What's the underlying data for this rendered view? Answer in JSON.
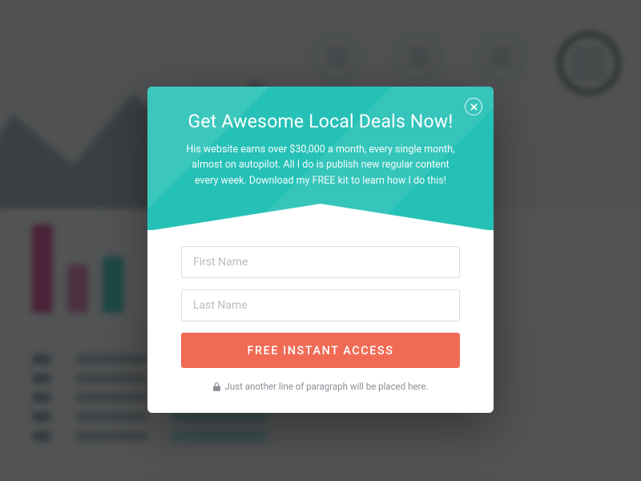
{
  "modal": {
    "title": "Get Awesome Local Deals Now!",
    "subtitle": "His website earns over $30,000 a month, every single month, almost on autopilot. All I do is publish new regular content every week. Download my FREE kit to learn how I do this!",
    "first_name_placeholder": "First Name",
    "last_name_placeholder": "Last Name",
    "cta_label": "FREE INSTANT ACCESS",
    "footer_text": "Just another line of paragraph will be placed here."
  },
  "colors": {
    "accent": "#26c1b6",
    "cta": "#f16a54"
  }
}
